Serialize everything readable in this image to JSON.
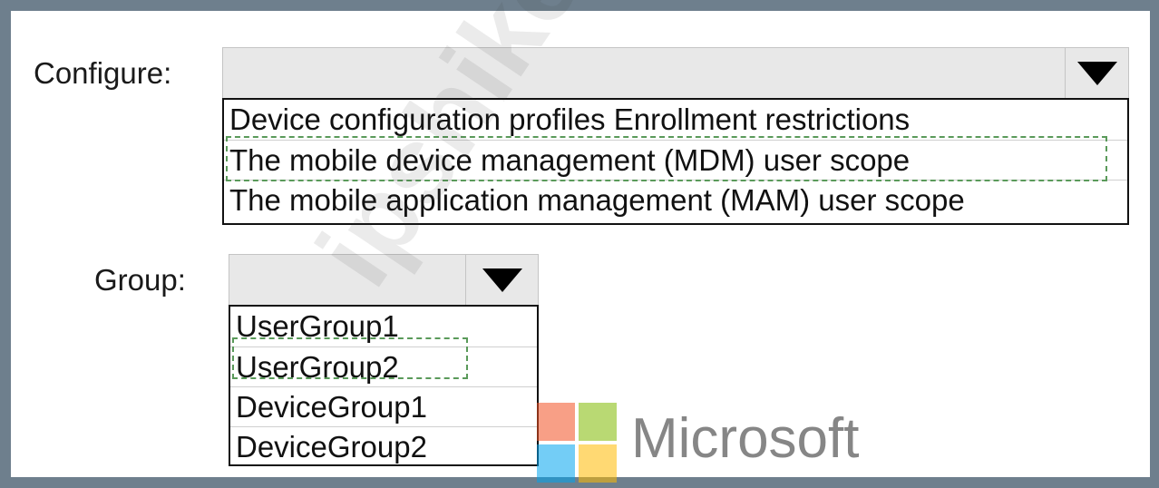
{
  "configure": {
    "label": "Configure:",
    "selected": "",
    "options": [
      "Device configuration profiles Enrollment restrictions",
      "The mobile device management (MDM) user scope",
      "The mobile application management (MAM) user scope"
    ]
  },
  "group": {
    "label": "Group:",
    "selected": "",
    "options": [
      "UserGroup1",
      "UserGroup2",
      "DeviceGroup1",
      "DeviceGroup2"
    ]
  },
  "logo": {
    "text": "Microsoft",
    "colors": {
      "red": "#f25022",
      "green": "#7fba00",
      "blue": "#00a4ef",
      "yellow": "#ffb900"
    }
  },
  "watermark": "ipshiken.com"
}
